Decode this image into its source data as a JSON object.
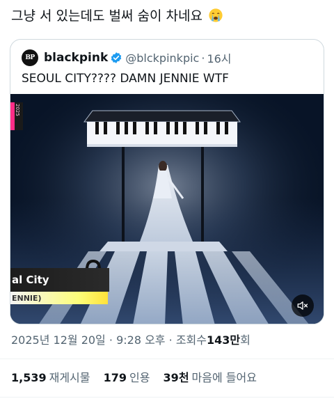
{
  "tweet": {
    "text": "그냥 서 있는데도 벌써 숨이 차네요",
    "emoji": "loudly-crying-face"
  },
  "quote": {
    "avatar_text": "BP",
    "name": "blackpink",
    "verified": true,
    "handle": "@blckpinkpic",
    "separator": "·",
    "time": "16시",
    "text": "SEOUL CITY???? DAMN JENNIE WTF"
  },
  "media": {
    "overlay_title": "al City",
    "overlay_subtitle": "ENNIE)",
    "side_label": "2025",
    "mute_icon": "speaker-muted-icon"
  },
  "meta": {
    "date": "2025년 12월 20일",
    "dot1": "·",
    "time": "9:28 오후",
    "dot2": "·",
    "views_prefix": "조회수",
    "views_value": "143만",
    "views_suffix": "회"
  },
  "stats": {
    "reposts_value": "1,539",
    "reposts_label": "재게시물",
    "quotes_value": "179",
    "quotes_label": "인용",
    "likes_value": "39천",
    "likes_label": "마음에 들어요"
  },
  "colors": {
    "text": "#0f1419",
    "secondary": "#536471",
    "border": "#cfd9de",
    "verified": "#1d9bf0",
    "heart_pink": "#ff2d87"
  }
}
